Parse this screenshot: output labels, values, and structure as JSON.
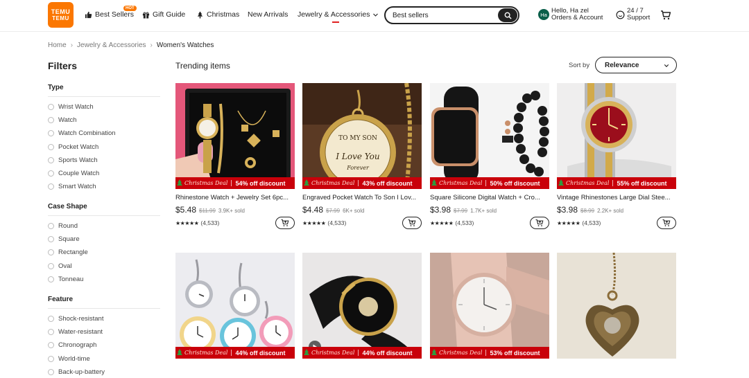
{
  "header": {
    "logo_line1": "TEMU",
    "logo_line2": "TEMU",
    "nav": [
      {
        "label": "Best Sellers",
        "icon": "thumbs-up-icon"
      },
      {
        "label": "Gift Guide",
        "icon": "gift-icon"
      },
      {
        "label": "Christmas",
        "icon": "christmas-tree-icon"
      },
      {
        "label": "New Arrivals"
      },
      {
        "label": "Jewelry & Accessories",
        "icon": "chevron-down-icon"
      }
    ],
    "hot_badge": "HOT",
    "search_value": "Best sellers",
    "account": {
      "avatar": "Ha",
      "line1": "Hello, Ha zel",
      "line2": "Orders & Account"
    },
    "support": {
      "line1": "24 / 7",
      "line2": "Support"
    }
  },
  "breadcrumb": [
    "Home",
    "Jewelry & Accessories",
    "Women's Watches"
  ],
  "sidebar": {
    "title": "Filters",
    "groups": [
      {
        "title": "Type",
        "options": [
          "Wrist Watch",
          "Watch",
          "Watch Combination",
          "Pocket Watch",
          "Sports Watch",
          "Couple Watch",
          "Smart Watch"
        ]
      },
      {
        "title": "Case Shape",
        "options": [
          "Round",
          "Square",
          "Rectangle",
          "Oval",
          "Tonneau"
        ]
      },
      {
        "title": "Feature",
        "options": [
          "Shock-resistant",
          "Water-resistant",
          "Chronograph",
          "World-time",
          "Back-up-battery"
        ]
      }
    ]
  },
  "main": {
    "heading": "Trending items",
    "sort_label": "Sort by",
    "sort_value": "Relevance",
    "deal_label": "Christmas Deal",
    "products": [
      {
        "title": "Rhinestone Watch + Jewelry Set 6pc...",
        "discount": "54% off discount",
        "price": "$5.48",
        "old_price": "$11.99",
        "sold": "3.9K+ sold",
        "reviews": "(4,533)"
      },
      {
        "title": "Engraved Pocket Watch To Son I Lov...",
        "discount": "43% off discount",
        "price": "$4.48",
        "old_price": "$7.99",
        "sold": "6K+ sold",
        "reviews": "(4,533)"
      },
      {
        "title": "Square Silicone Digital Watch + Cro...",
        "discount": "50% off discount",
        "price": "$3.98",
        "old_price": "$7.99",
        "sold": "1.7K+ sold",
        "reviews": "(4,533)"
      },
      {
        "title": "Vintage Rhinestones Large Dial Stee...",
        "discount": "55% off discount",
        "price": "$3.98",
        "old_price": "$8.99",
        "sold": "2.2K+ sold",
        "reviews": "(4,533)"
      },
      {
        "discount": "44% off discount"
      },
      {
        "discount": "44% off discount"
      },
      {
        "discount": "53% off discount"
      },
      {
        "discount": ""
      }
    ]
  },
  "colors": {
    "brand": "#fb7701",
    "deal_red": "#c9000a",
    "text": "#222222"
  }
}
